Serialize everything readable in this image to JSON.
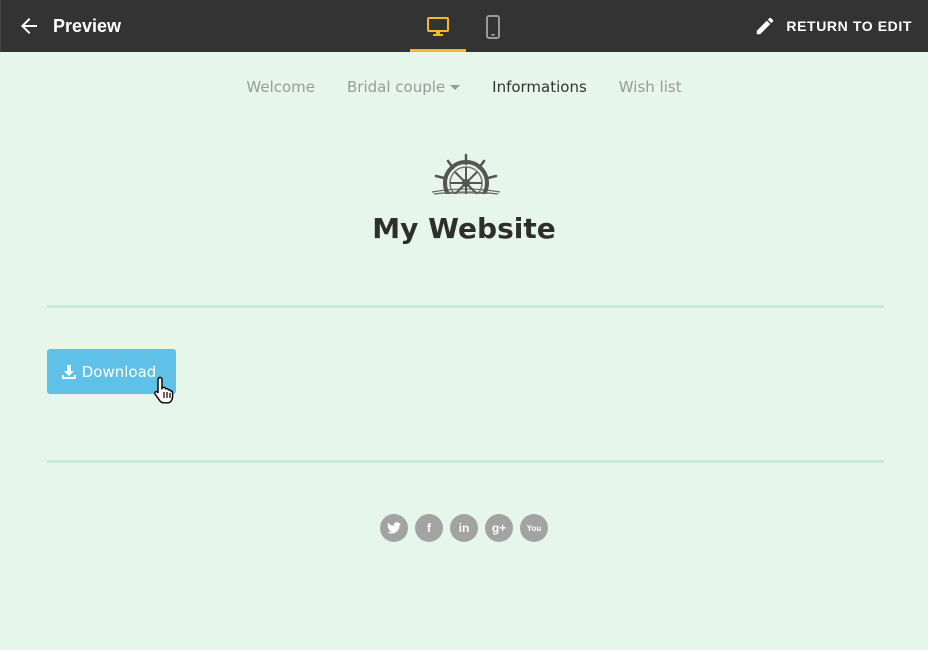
{
  "topbar": {
    "title": "Preview",
    "back_icon": "arrow-left-icon",
    "device_tabs": [
      {
        "name": "desktop",
        "icon": "monitor-icon",
        "active": true,
        "color": "#f5b928"
      },
      {
        "name": "mobile",
        "icon": "phone-icon",
        "active": false
      }
    ],
    "return_label": "RETURN TO EDIT",
    "return_icon": "pencil-icon"
  },
  "site": {
    "menu": [
      {
        "label": "Welcome",
        "active": false
      },
      {
        "label": "Bridal couple",
        "active": false,
        "has_dropdown": true
      },
      {
        "label": "Informations",
        "active": true
      },
      {
        "label": "Wish list",
        "active": false
      }
    ],
    "logo_icon": "ship-wheel-icon",
    "title": "My Website",
    "download_label": "Download",
    "download_icon": "download-icon",
    "social": [
      {
        "icon": "twitter-icon",
        "glyph": "t"
      },
      {
        "icon": "facebook-icon",
        "glyph": "f"
      },
      {
        "icon": "linkedin-icon",
        "glyph": "in"
      },
      {
        "icon": "google-plus-icon",
        "glyph": "g+"
      },
      {
        "icon": "youtube-icon",
        "glyph": "You"
      }
    ]
  },
  "colors": {
    "topbar": "#333333",
    "accent": "#f5b928",
    "page_bg": "#e6f6ea",
    "button": "#5fc0e8",
    "divider": "#c7ecd4"
  }
}
